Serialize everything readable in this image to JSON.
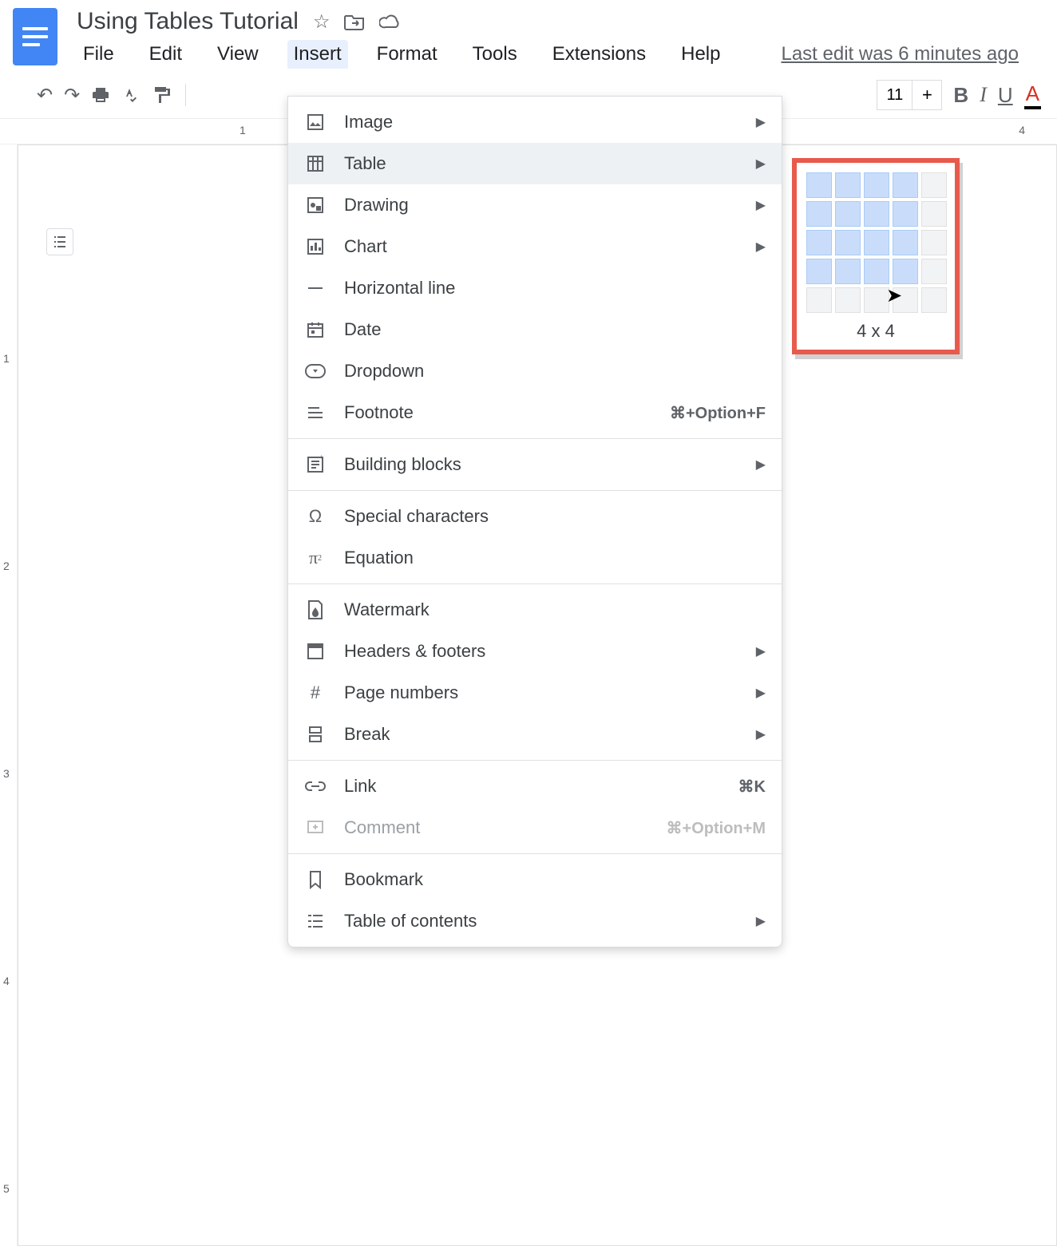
{
  "document": {
    "title": "Using Tables Tutorial"
  },
  "menu": {
    "file": "File",
    "edit": "Edit",
    "view": "View",
    "insert": "Insert",
    "format": "Format",
    "tools": "Tools",
    "extensions": "Extensions",
    "help": "Help",
    "last_edit": "Last edit was 6 minutes ago"
  },
  "toolbar": {
    "font_size": "11"
  },
  "ruler": {
    "h1": "1",
    "h4": "4",
    "v1": "1",
    "v2": "2",
    "v3": "3",
    "v4": "4",
    "v5": "5"
  },
  "insert_menu": {
    "image": "Image",
    "table": "Table",
    "drawing": "Drawing",
    "chart": "Chart",
    "hline": "Horizontal line",
    "date": "Date",
    "dropdown": "Dropdown",
    "footnote": "Footnote",
    "footnote_sc": "⌘+Option+F",
    "building_blocks": "Building blocks",
    "special": "Special characters",
    "equation": "Equation",
    "watermark": "Watermark",
    "headers": "Headers & footers",
    "page_numbers": "Page numbers",
    "break": "Break",
    "link": "Link",
    "link_sc": "⌘K",
    "comment": "Comment",
    "comment_sc": "⌘+Option+M",
    "bookmark": "Bookmark",
    "toc": "Table of contents"
  },
  "table_picker": {
    "label": "4 x 4",
    "rows": 4,
    "cols": 4
  }
}
